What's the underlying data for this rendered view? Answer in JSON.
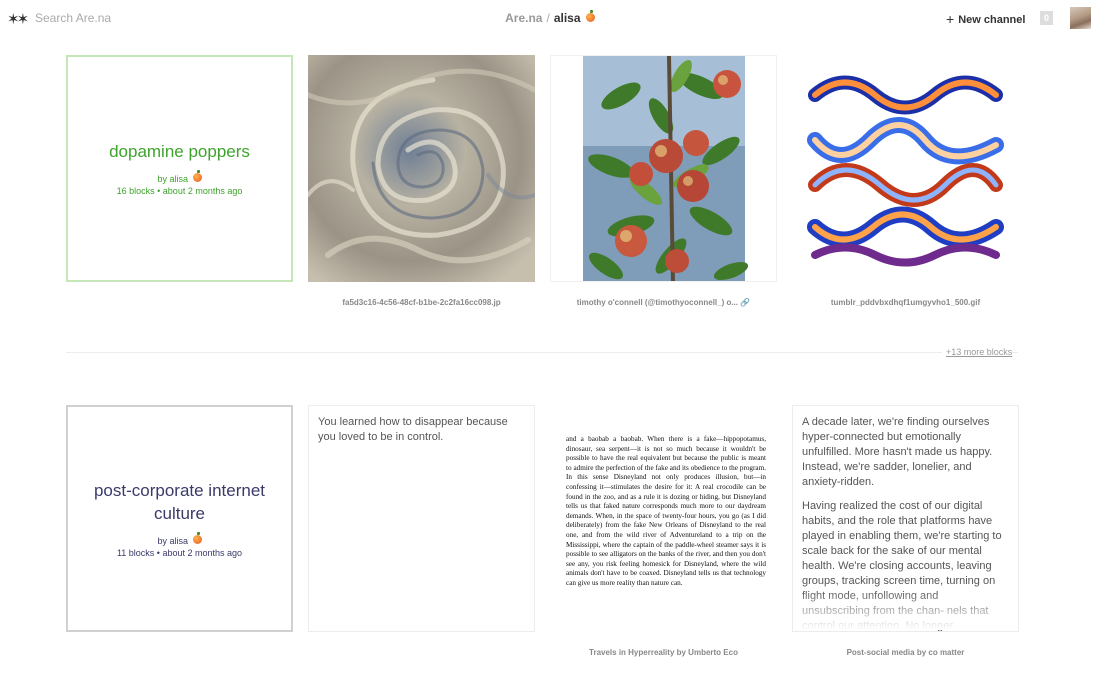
{
  "header": {
    "logo": "✶✶",
    "search_placeholder": "Search Are.na",
    "breadcrumb_site": "Are.na",
    "breadcrumb_separator": "/",
    "breadcrumb_user": "alisa",
    "new_channel_label": "New channel",
    "notification_count": "0"
  },
  "row1": {
    "channel": {
      "title": "dopamine poppers",
      "by": "by alisa",
      "meta": "16 blocks • about 2 months ago"
    },
    "blocks": [
      {
        "kind": "image",
        "icon": "jupiter-swirl-image",
        "caption": "fa5d3c16-4c56-48cf-b1be-2c2fa16cc098.jp"
      },
      {
        "kind": "image",
        "icon": "apple-tree-image",
        "caption": "timothy o'connell (@timothyoconnell_) o... 🔗"
      },
      {
        "kind": "image",
        "icon": "colorful-waves-gif",
        "caption": "tumblr_pddvbxdhqf1umgyvho1_500.gif"
      }
    ],
    "more_link": "+13 more blocks"
  },
  "row2": {
    "channel": {
      "title": "post-corporate internet culture",
      "by": "by alisa",
      "meta": "11 blocks • about 2 months ago"
    },
    "text_block_1": "You learned how to disappear because you loved to be in control.",
    "book_caption": "Travels in Hyperreality by Umberto Eco",
    "book_text": "and a baobab a baobab. When there is a fake—hippopotamus, dinosaur, sea serpent—it is not so much because it wouldn't be possible to have the real equivalent but because the public is meant to admire the perfection of the fake and its obedience to the program. In this sense Disneyland not only produces illusion, but—in confessing it—stimulates the desire for it: A real crocodile can be found in the zoo, and as a rule it is dozing or hiding, but Disneyland tells us that faked nature corresponds much more to our daydream demands. When, in the space of twenty-four hours, you go (as I did deliberately) from the fake New Orleans of Disneyland to the real one, and from the wild river of Adventureland to a trip on the Mississippi, where the captain of the paddle-wheel steamer says it is possible to see alligators on the banks of the river, and then you don't see any, you risk feeling homesick for Disneyland, where the wild animals don't have to be coaxed. Disneyland tells us that technology can give us more reality than nature can.",
    "text_block_2": [
      "A decade later, we're finding ourselves hyper-connected but emotionally unfulfilled. More hasn't made us happy. Instead, we're sadder, lonelier, and anxiety-ridden.",
      "Having realized the cost of our digital habits, and the role that platforms have played in enabling them, we're starting to scale back for the sake of our mental health. We're closing accounts, leaving groups, tracking screen time, turning on flight mode, unfollowing and unsubscribing from the chan- nels that control our attention. No longer considered poor social etiquette, these steps towards mindful reduction are"
    ],
    "text_block_2_caption": "Post-social media by co matter"
  },
  "colors": {
    "channel_green": "#3ea32b",
    "channel_green_border": "#c5e6b8",
    "channel_private": "#3a3a6a"
  }
}
